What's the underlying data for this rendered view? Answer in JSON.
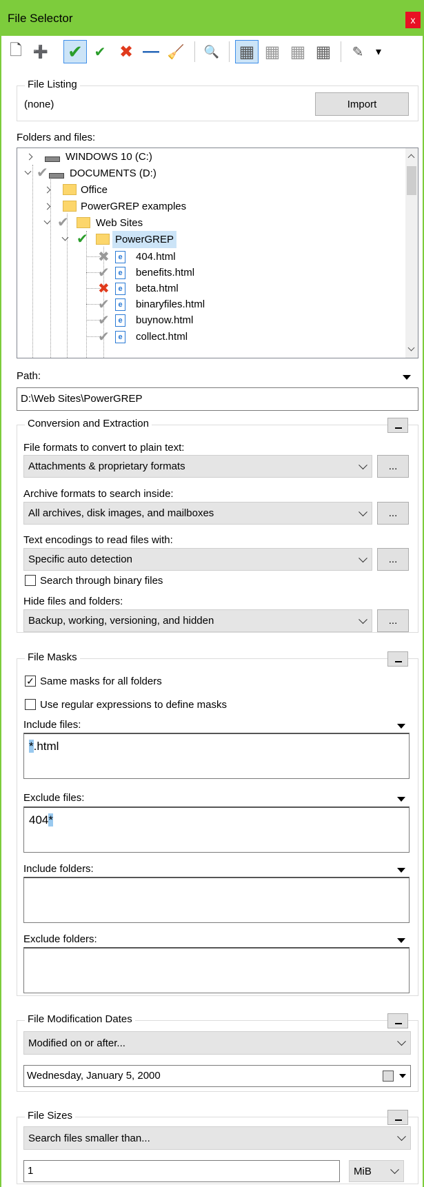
{
  "window": {
    "title": "File Selector",
    "close_label": "x"
  },
  "toolbar": {
    "buttons": [
      {
        "name": "new-icon",
        "glyph": "🗋"
      },
      {
        "name": "add-folder-icon",
        "glyph": "➕"
      },
      {
        "name": "include-icon",
        "glyph": "✔"
      },
      {
        "name": "include-files-icon",
        "glyph": "✔"
      },
      {
        "name": "exclude-icon",
        "glyph": "✖"
      },
      {
        "name": "clear-icon",
        "glyph": "—"
      },
      {
        "name": "broom-icon",
        "glyph": "🧹"
      },
      {
        "name": "view-icon",
        "glyph": "🔍"
      },
      {
        "name": "filter-a-icon",
        "glyph": "▦"
      },
      {
        "name": "filter-b-icon",
        "glyph": "▦"
      },
      {
        "name": "filter-c-icon",
        "glyph": "▦"
      },
      {
        "name": "filter-d-icon",
        "glyph": "▦"
      },
      {
        "name": "edit-icon",
        "glyph": "✎"
      },
      {
        "name": "dropdown-icon",
        "glyph": "▾"
      }
    ]
  },
  "file_listing": {
    "label": "File Listing",
    "value": "(none)",
    "import_label": "Import"
  },
  "folders": {
    "label": "Folders and files:",
    "nodes": [
      {
        "label": "WINDOWS 10 (C:)"
      },
      {
        "label": "DOCUMENTS (D:)"
      },
      {
        "label": "Office"
      },
      {
        "label": "PowerGREP examples"
      },
      {
        "label": "Web Sites"
      },
      {
        "label": "PowerGREP"
      },
      {
        "label": "404.html"
      },
      {
        "label": "benefits.html"
      },
      {
        "label": "beta.html"
      },
      {
        "label": "binaryfiles.html"
      },
      {
        "label": "buynow.html"
      },
      {
        "label": "collect.html"
      }
    ]
  },
  "path": {
    "label": "Path:",
    "value": "D:\\Web Sites\\PowerGREP"
  },
  "conversion": {
    "label": "Conversion and Extraction",
    "formats_label": "File formats to convert to plain text:",
    "formats_value": "Attachments & proprietary formats",
    "archives_label": "Archive formats to search inside:",
    "archives_value": "All archives, disk images, and mailboxes",
    "encodings_label": "Text encodings to read files with:",
    "encodings_value": "Specific auto detection",
    "binary_label": "Search through binary files",
    "hide_label": "Hide files and folders:",
    "hide_value": "Backup, working, versioning, and hidden",
    "more_label": "..."
  },
  "masks": {
    "label": "File Masks",
    "same_label": "Same masks for all folders",
    "regex_label": "Use regular expressions to define masks",
    "include_files_label": "Include files:",
    "include_files_hl": "*",
    "include_files_rest": ".html",
    "exclude_files_label": "Exclude files:",
    "exclude_files_rest": "404",
    "exclude_files_hl": "*",
    "include_folders_label": "Include folders:",
    "exclude_folders_label": "Exclude folders:"
  },
  "dates": {
    "label": "File Modification Dates",
    "mode": "Modified on or after...",
    "date": "Wednesday,   January    5, 2000"
  },
  "sizes": {
    "label": "File Sizes",
    "mode": "Search files smaller than...",
    "value": "1",
    "unit": "MiB"
  },
  "colors": {
    "accent": "#7dcc3c",
    "close": "#e81123",
    "check": "#2a9d2a",
    "cross": "#e03a1c",
    "highlight": "#cce4f7"
  }
}
